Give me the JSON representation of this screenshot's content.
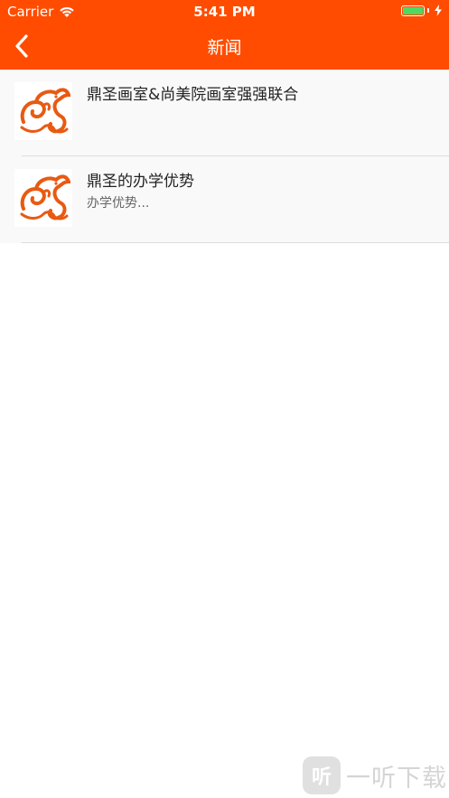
{
  "status_bar": {
    "carrier": "Carrier",
    "time": "5:41 PM",
    "battery_level": 1.0
  },
  "nav": {
    "title": "新闻",
    "back_icon": "chevron-left-icon"
  },
  "colors": {
    "brand": "#FF4C00",
    "list_bg": "#F9F9F9",
    "battery": "#4CD964"
  },
  "news": [
    {
      "title": "鼎圣画室&尚美院画室强强联合",
      "summary": ""
    },
    {
      "title": "鼎圣的办学优势",
      "summary": "办学优势..."
    }
  ],
  "watermark": {
    "logo_text": "听",
    "text": "一听下载"
  }
}
